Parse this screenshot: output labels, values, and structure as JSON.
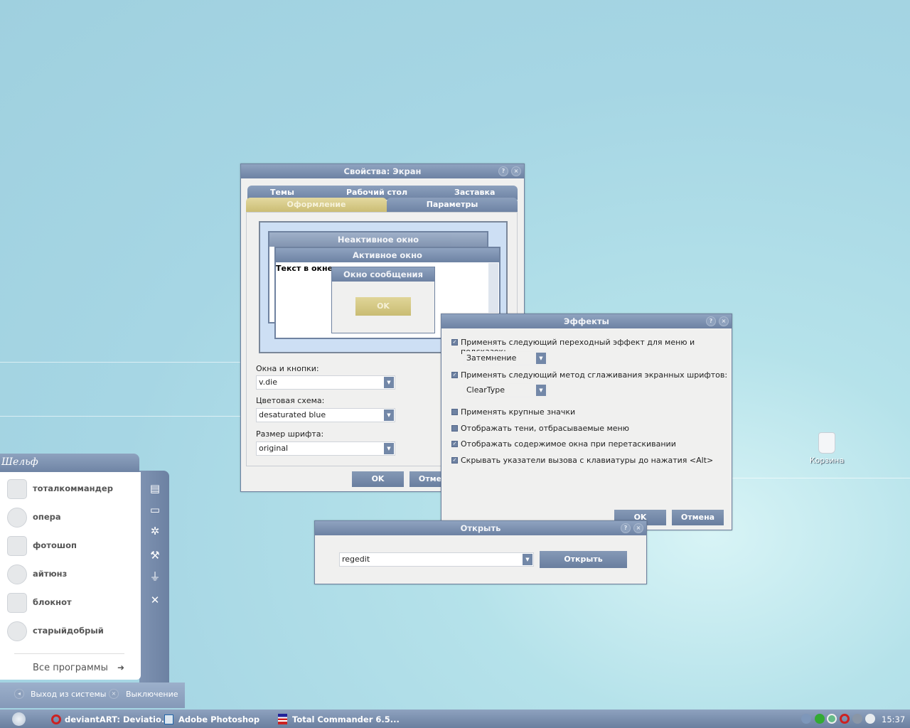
{
  "desktop": {
    "recycle_bin": "Корзина"
  },
  "display_props": {
    "title": "Свойства: Экран",
    "tabs_top": [
      "Темы",
      "Рабочий стол",
      "Заставка"
    ],
    "tabs_bottom": [
      "Оформление",
      "Параметры"
    ],
    "preview": {
      "inactive": "Неактивное окно",
      "active": "Активное окно",
      "text": "Текст в окне",
      "message": "Окно сообщения",
      "ok": "OK"
    },
    "windows_buttons_label": "Окна и кнопки:",
    "windows_buttons_value": "v.die",
    "color_scheme_label": "Цветовая схема:",
    "color_scheme_value": "desaturated blue",
    "font_size_label": "Размер шрифта:",
    "font_size_value": "original",
    "ok": "OK",
    "cancel": "Отмена"
  },
  "effects": {
    "title": "Эффекты",
    "options": [
      {
        "label": "Применять следующий переходный эффект для меню и подсказок:",
        "checked": true,
        "select": "Затемнение"
      },
      {
        "label": "Применять следующий метод сглаживания экранных шрифтов:",
        "checked": true,
        "select": "ClearType"
      },
      {
        "label": "Применять крупные значки",
        "checked": false
      },
      {
        "label": "Отображать тени, отбрасываемые меню",
        "checked": false
      },
      {
        "label": "Отображать содержимое окна при перетаскивании",
        "checked": true
      },
      {
        "label": "Скрывать указатели вызова с клавиатуры до нажатия <Alt>",
        "checked": true
      }
    ],
    "ok": "OK",
    "cancel": "Отмена"
  },
  "run": {
    "title": "Открыть",
    "value": "regedit",
    "open": "Открыть"
  },
  "start_menu": {
    "header": "Шельф",
    "items": [
      "тоталкоммандер",
      "опера",
      "фотошоп",
      "айтюнз",
      "блокнот",
      "старыйдобрый"
    ],
    "all_programs": "Все программы",
    "logoff": "Выход из системы",
    "shutdown": "Выключение"
  },
  "taskbar": {
    "tasks": [
      "deviantART: Deviatio...",
      "Adobe Photoshop",
      "Total Commander 6.5..."
    ],
    "clock": "15:37"
  }
}
